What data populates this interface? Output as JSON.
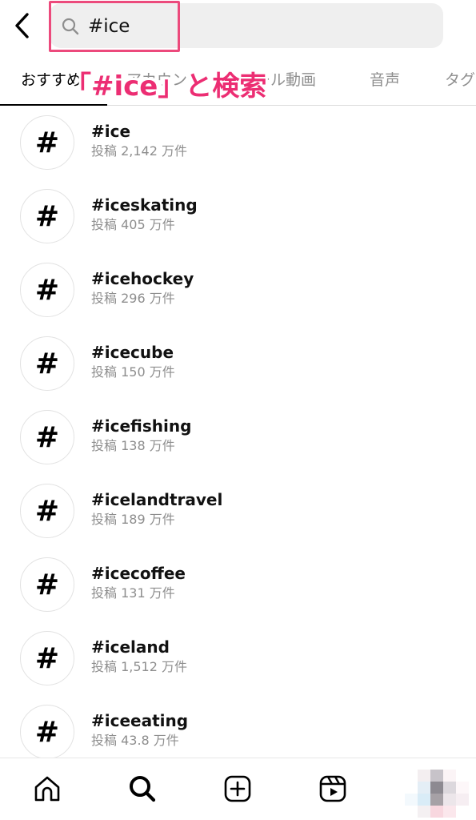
{
  "search": {
    "value": "#ice",
    "back_icon": "chevron-left-icon",
    "search_icon": "search-icon"
  },
  "annotation": {
    "text": "「#ice」と検索",
    "color": "#ec2e73"
  },
  "tabs": [
    {
      "label": "おすすめ",
      "active": true
    },
    {
      "label": "アカウント",
      "active": false
    },
    {
      "label": "リール動画",
      "active": false
    },
    {
      "label": "音声",
      "active": false
    },
    {
      "label": "タグ",
      "active": false
    }
  ],
  "results": [
    {
      "tag": "#ice",
      "posts": "投稿 2,142 万件"
    },
    {
      "tag": "#iceskating",
      "posts": "投稿 405 万件"
    },
    {
      "tag": "#icehockey",
      "posts": "投稿 296 万件"
    },
    {
      "tag": "#icecube",
      "posts": "投稿 150 万件"
    },
    {
      "tag": "#icefishing",
      "posts": "投稿 138 万件"
    },
    {
      "tag": "#icelandtravel",
      "posts": "投稿 189 万件"
    },
    {
      "tag": "#icecoffee",
      "posts": "投稿 131 万件"
    },
    {
      "tag": "#iceland",
      "posts": "投稿 1,512 万件"
    },
    {
      "tag": "#iceeating",
      "posts": "投稿 43.8 万件"
    }
  ],
  "hash_symbol": "#",
  "bottom_nav": [
    {
      "icon": "home-icon"
    },
    {
      "icon": "search-icon",
      "active": true
    },
    {
      "icon": "add-post-icon"
    },
    {
      "icon": "reels-icon"
    },
    {
      "icon": "profile-avatar"
    }
  ]
}
